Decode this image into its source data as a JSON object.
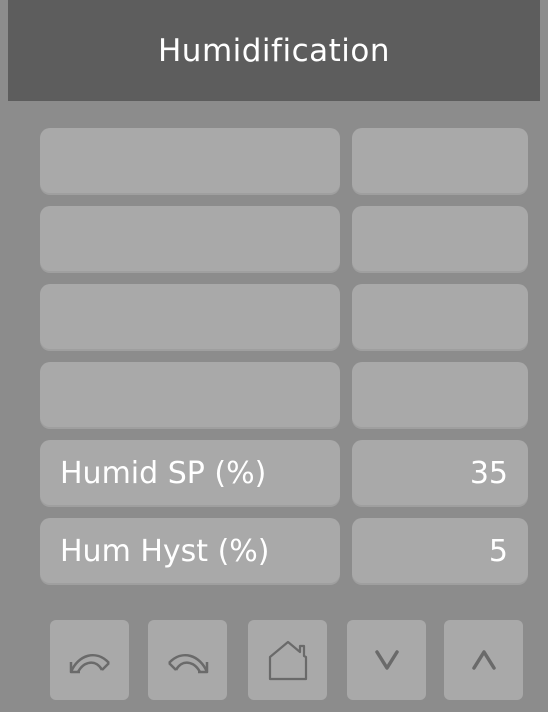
{
  "header": {
    "title": "Humidification"
  },
  "rows": [
    {
      "label": "",
      "value": ""
    },
    {
      "label": "",
      "value": ""
    },
    {
      "label": "",
      "value": ""
    },
    {
      "label": "",
      "value": ""
    },
    {
      "label": "Humid SP (%)",
      "value": "35"
    },
    {
      "label": "Hum Hyst (%)",
      "value": "5"
    }
  ],
  "nav": {
    "buttons": [
      "back-icon",
      "forward-icon",
      "home-icon",
      "down-icon",
      "up-icon"
    ]
  },
  "colors": {
    "background": "#8c8c8c",
    "header": "#5d5d5d",
    "field": "#a9a9a9",
    "text": "#ffffff",
    "icon": "#6a6a6a"
  }
}
